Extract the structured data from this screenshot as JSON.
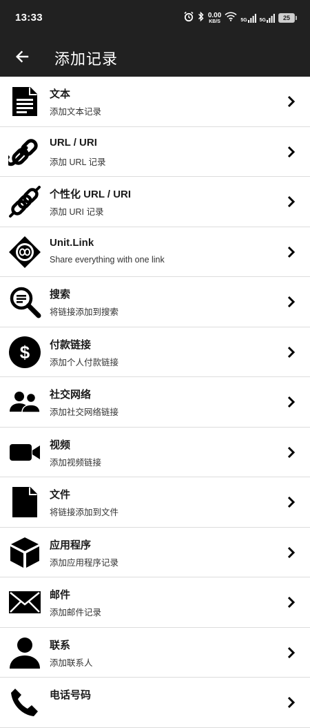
{
  "status_bar": {
    "time": "13:33",
    "net_speed": "0.00",
    "net_unit": "KB/S",
    "signal1_label": "5G",
    "signal2_label": "5G",
    "battery": "25",
    "icons": [
      "alarm-icon",
      "bluetooth-icon",
      "wifi-icon",
      "signal-icon",
      "battery-icon"
    ]
  },
  "app_bar": {
    "title": "添加记录",
    "back_icon": "arrow-left-icon",
    "background": "#212121"
  },
  "records": [
    {
      "title": "文本",
      "subtitle": "添加文本记录",
      "icon": "document-text-icon"
    },
    {
      "title": "URL / URI",
      "subtitle": "添加 URL 记录",
      "icon": "link-icon"
    },
    {
      "title": "个性化 URL / URI",
      "subtitle": "添加 URI 记录",
      "icon": "custom-link-icon"
    },
    {
      "title": "Unit.Link",
      "subtitle": "Share everything with one link",
      "icon": "unit-link-icon"
    },
    {
      "title": "搜索",
      "subtitle": "将链接添加到搜索",
      "icon": "search-icon"
    },
    {
      "title": "付款链接",
      "subtitle": "添加个人付款链接",
      "icon": "dollar-icon"
    },
    {
      "title": "社交网络",
      "subtitle": "添加社交网络链接",
      "icon": "people-icon"
    },
    {
      "title": "视频",
      "subtitle": "添加视频链接",
      "icon": "video-camera-icon"
    },
    {
      "title": "文件",
      "subtitle": "将链接添加到文件",
      "icon": "file-icon"
    },
    {
      "title": "应用程序",
      "subtitle": "添加应用程序记录",
      "icon": "cube-icon"
    },
    {
      "title": "邮件",
      "subtitle": "添加邮件记录",
      "icon": "envelope-icon"
    },
    {
      "title": "联系",
      "subtitle": "添加联系人",
      "icon": "person-icon"
    },
    {
      "title": "电话号码",
      "subtitle": "",
      "icon": "phone-icon"
    }
  ],
  "chevron_icon": "chevron-right-icon"
}
